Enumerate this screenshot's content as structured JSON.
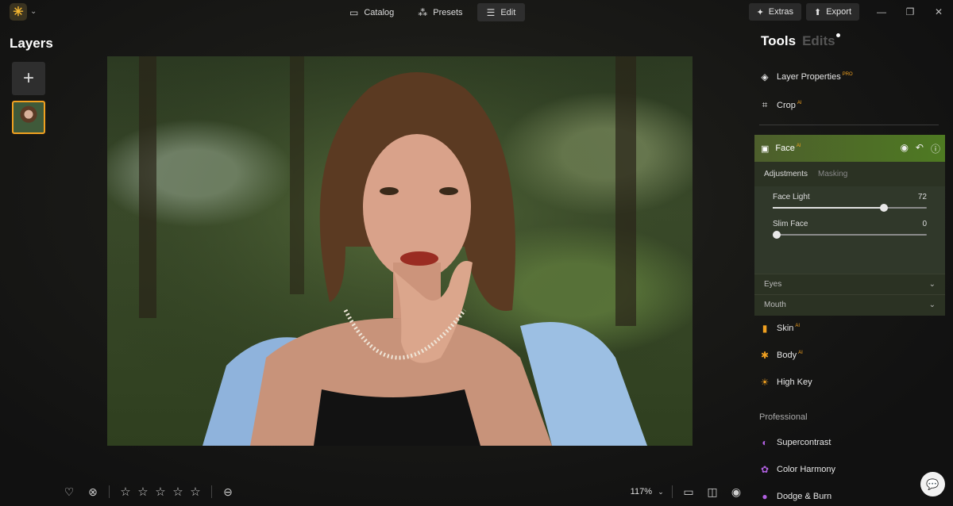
{
  "topbar": {
    "nav": [
      {
        "label": "Catalog",
        "icon": "folder-icon"
      },
      {
        "label": "Presets",
        "icon": "sparkle-wand-icon"
      },
      {
        "label": "Edit",
        "icon": "sliders-icon",
        "active": true
      }
    ],
    "extras_label": "Extras",
    "export_label": "Export"
  },
  "left": {
    "title": "Layers"
  },
  "right": {
    "tools_title": "Tools",
    "edits_title": "Edits",
    "tools": [
      {
        "label": "Layer Properties",
        "badge": "PRO",
        "icon": "layers-icon"
      },
      {
        "label": "Crop",
        "badge": "AI",
        "icon": "crop-icon"
      }
    ],
    "face": {
      "label": "Face",
      "badge": "AI",
      "tabs": [
        "Adjustments",
        "Masking"
      ],
      "sliders": [
        {
          "label": "Face Light",
          "value": "72",
          "fraction": 0.72
        },
        {
          "label": "Slim Face",
          "value": "0",
          "fraction": 0.0
        }
      ],
      "sections": [
        "Eyes",
        "Mouth"
      ]
    },
    "more_tools": [
      {
        "label": "Skin",
        "badge": "AI",
        "icon": "skin-icon",
        "color": "#f0a020"
      },
      {
        "label": "Body",
        "badge": "AI",
        "icon": "body-icon",
        "color": "#f0a020"
      },
      {
        "label": "High Key",
        "badge": "",
        "icon": "high-key-icon",
        "color": "#f0a020"
      }
    ],
    "professional_label": "Professional",
    "pro_tools": [
      {
        "label": "Supercontrast",
        "icon": "supercontrast-icon",
        "color": "#b060e0"
      },
      {
        "label": "Color Harmony",
        "icon": "color-harmony-icon",
        "color": "#b060e0"
      },
      {
        "label": "Dodge & Burn",
        "icon": "dodge-burn-icon",
        "color": "#b060e0"
      }
    ]
  },
  "bottom": {
    "zoom": "117%",
    "rating_stars": 5
  },
  "colors": {
    "accent": "#f0a020",
    "face_header": "#4e7a22",
    "panel_bg": "#2b3223"
  }
}
